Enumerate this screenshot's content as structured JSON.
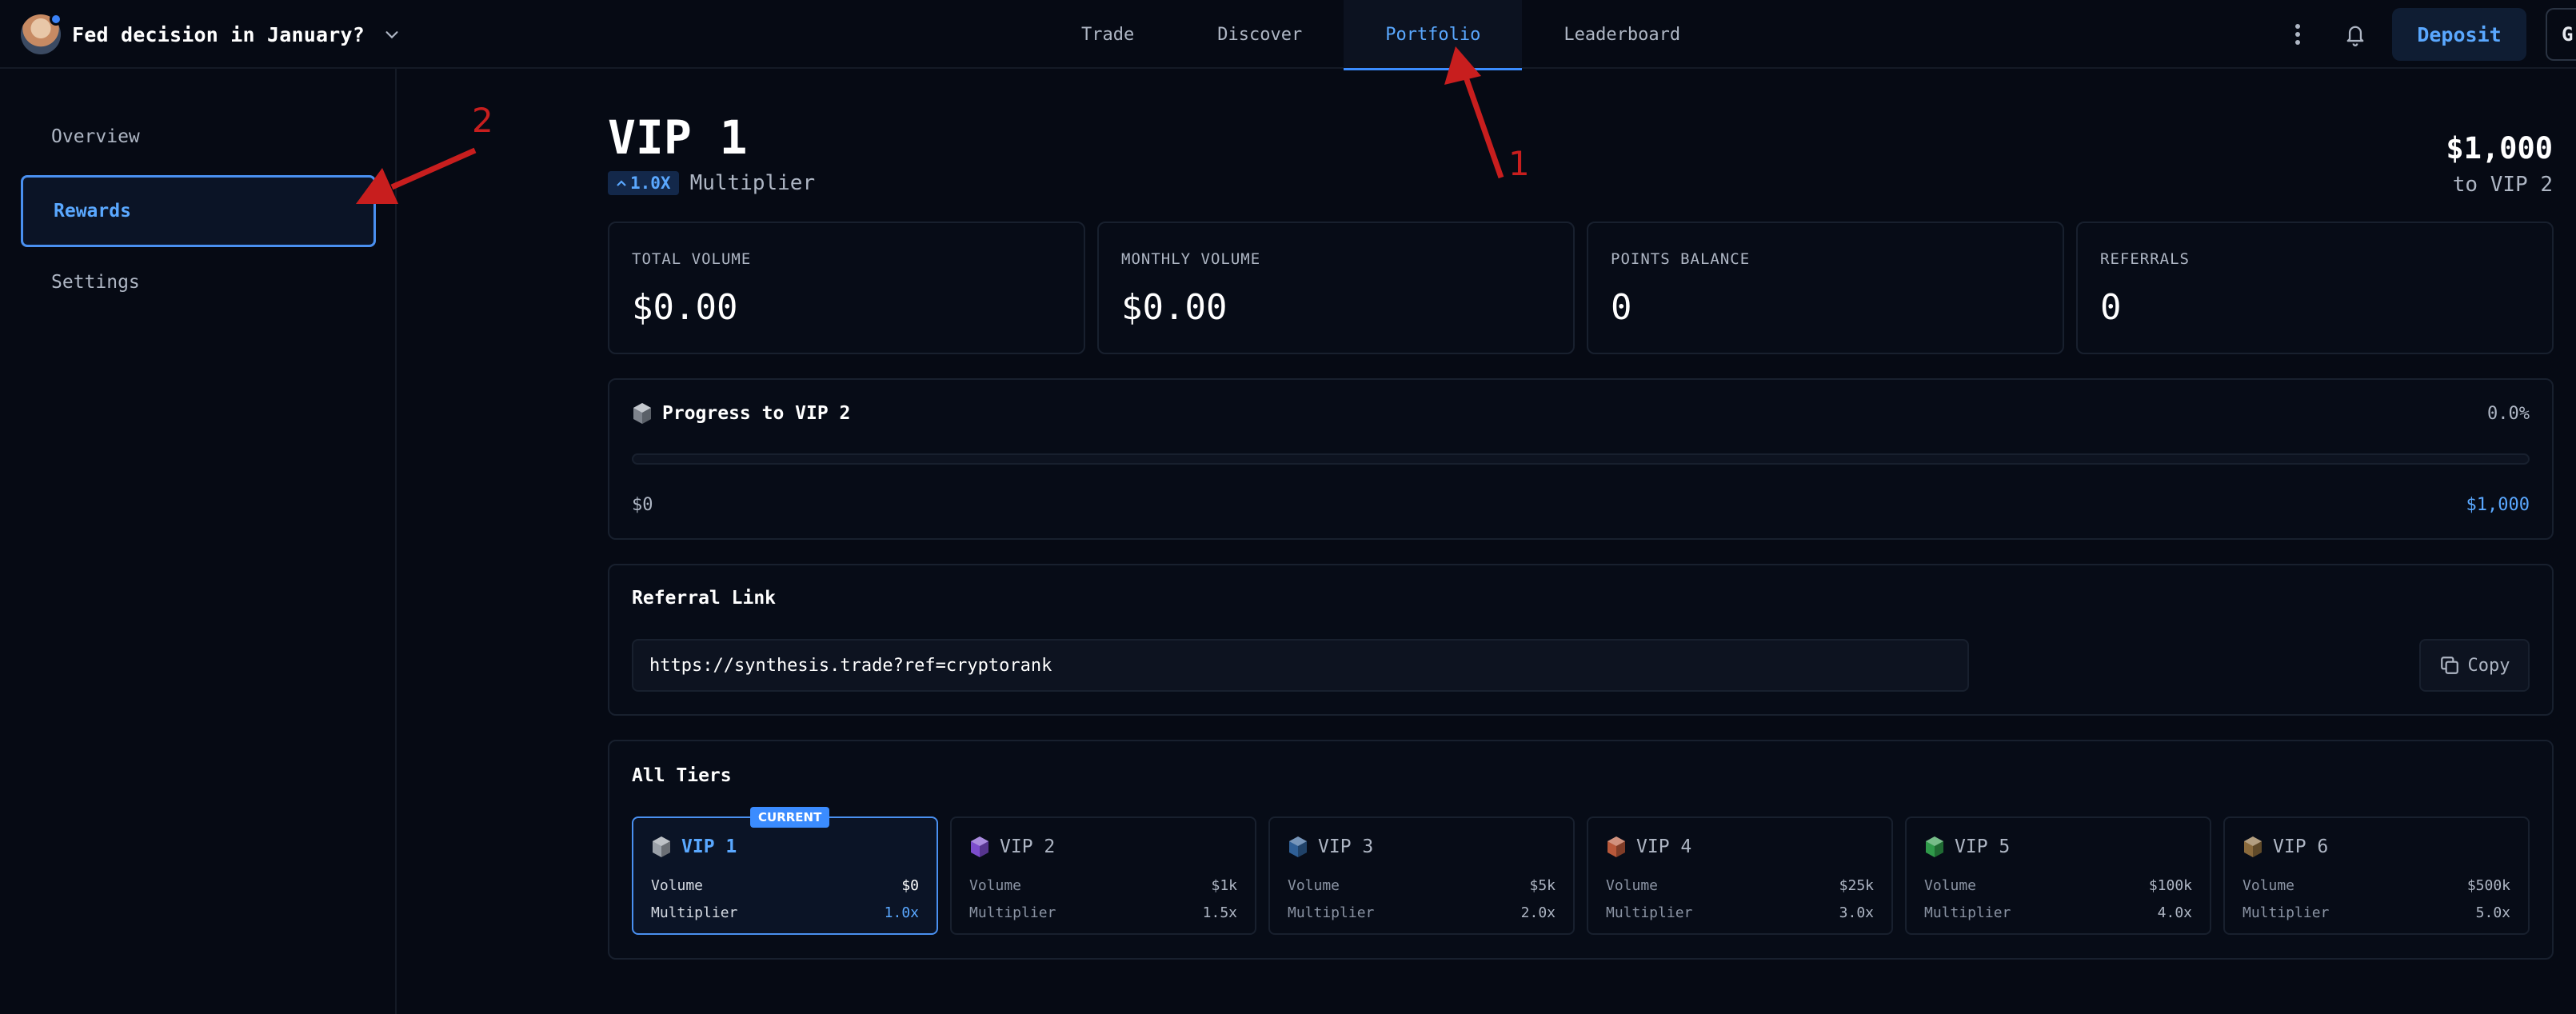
{
  "header": {
    "market_title": "Fed decision in January?",
    "nav": [
      {
        "label": "Trade",
        "active": false
      },
      {
        "label": "Discover",
        "active": false
      },
      {
        "label": "Portfolio",
        "active": true
      },
      {
        "label": "Leaderboard",
        "active": false
      }
    ],
    "deposit_label": "Deposit",
    "partial_button_label": "G",
    "accent_color": "#5aa8ff"
  },
  "sidebar": {
    "items": [
      {
        "label": "Overview",
        "active": false
      },
      {
        "label": "Rewards",
        "active": true
      },
      {
        "label": "Settings",
        "active": false
      }
    ]
  },
  "rewards": {
    "vip_title": "VIP 1",
    "multiplier_badge": "1.0X",
    "multiplier_label": "Multiplier",
    "next_amount": "$1,000",
    "next_label": "to VIP 2",
    "stats": [
      {
        "label": "TOTAL VOLUME",
        "value": "$0.00"
      },
      {
        "label": "MONTHLY VOLUME",
        "value": "$0.00"
      },
      {
        "label": "POINTS BALANCE",
        "value": "0"
      },
      {
        "label": "REFERRALS",
        "value": "0"
      }
    ],
    "progress": {
      "title": "Progress to VIP 2",
      "percent_label": "0.0%",
      "fraction": 0,
      "start_label": "$0",
      "end_label": "$1,000"
    },
    "referral": {
      "title": "Referral Link",
      "link": "https://synthesis.trade?ref=cryptorank",
      "copy_label": "Copy"
    },
    "tiers": {
      "title": "All Tiers",
      "current_badge": "CURRENT",
      "volume_label": "Volume",
      "multiplier_label": "Multiplier",
      "items": [
        {
          "name": "VIP 1",
          "volume": "$0",
          "multiplier": "1.0x",
          "color": "#9aa0a8",
          "current": true
        },
        {
          "name": "VIP 2",
          "volume": "$1k",
          "multiplier": "1.5x",
          "color": "#7c4dcc",
          "current": false
        },
        {
          "name": "VIP 3",
          "volume": "$5k",
          "multiplier": "2.0x",
          "color": "#2f5f96",
          "current": false
        },
        {
          "name": "VIP 4",
          "volume": "$25k",
          "multiplier": "3.0x",
          "color": "#b8583a",
          "current": false
        },
        {
          "name": "VIP 5",
          "volume": "$100k",
          "multiplier": "4.0x",
          "color": "#2f9a4a",
          "current": false
        },
        {
          "name": "VIP 6",
          "volume": "$500k",
          "multiplier": "5.0x",
          "color": "#8a6a3c",
          "current": false
        }
      ]
    }
  },
  "annotations": {
    "marker_1": "1",
    "marker_2": "2",
    "color": "#c81e1e"
  }
}
